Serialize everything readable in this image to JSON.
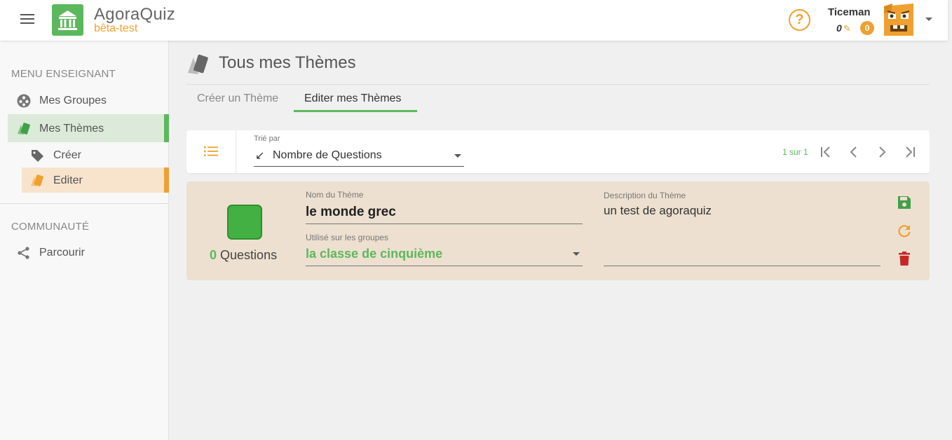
{
  "app": {
    "title": "AgoraQuiz",
    "subtitle": "bêta-test",
    "logo_icon": "temple-icon",
    "brand_color": "#5cb85c",
    "accent_color": "#f0a030"
  },
  "header": {
    "help_label": "?",
    "username": "Ticeman",
    "points": "0",
    "coins": "0"
  },
  "sidebar": {
    "teacher_heading": "MENU ENSEIGNANT",
    "items": [
      {
        "label": "Mes Groupes",
        "icon": "groups-icon"
      },
      {
        "label": "Mes Thèmes",
        "icon": "cards-icon",
        "active": true
      },
      {
        "label": "Créer",
        "icon": "tag-icon"
      },
      {
        "label": "Editer",
        "icon": "cards-icon",
        "active": true
      }
    ],
    "community_heading": "COMMUNAUTÉ",
    "community_items": [
      {
        "label": "Parcourir",
        "icon": "share-icon"
      }
    ]
  },
  "main": {
    "page_title": "Tous mes Thèmes",
    "tabs": [
      {
        "label": "Créer un Thème",
        "active": false
      },
      {
        "label": "Editer mes Thèmes",
        "active": true
      }
    ],
    "toolbar": {
      "sort_label": "Trié par",
      "sort_arrow": "↙",
      "sort_value": "Nombre de Questions",
      "page_info": "1 sur 1"
    },
    "theme_card": {
      "swatch_color": "#43b043",
      "question_count": "0",
      "question_label": "Questions",
      "name_label": "Nom du Thème",
      "name_value": "le monde grec",
      "groups_label": "Utilisé sur les groupes",
      "groups_value": "la classe de cinquième",
      "description_label": "Description du Thème",
      "description_value": "un test de agoraquiz",
      "actions": [
        {
          "icon": "save-icon",
          "color": "#43a047"
        },
        {
          "icon": "refresh-icon",
          "color": "#f0a030"
        },
        {
          "icon": "delete-icon",
          "color": "#c62828"
        }
      ]
    }
  }
}
